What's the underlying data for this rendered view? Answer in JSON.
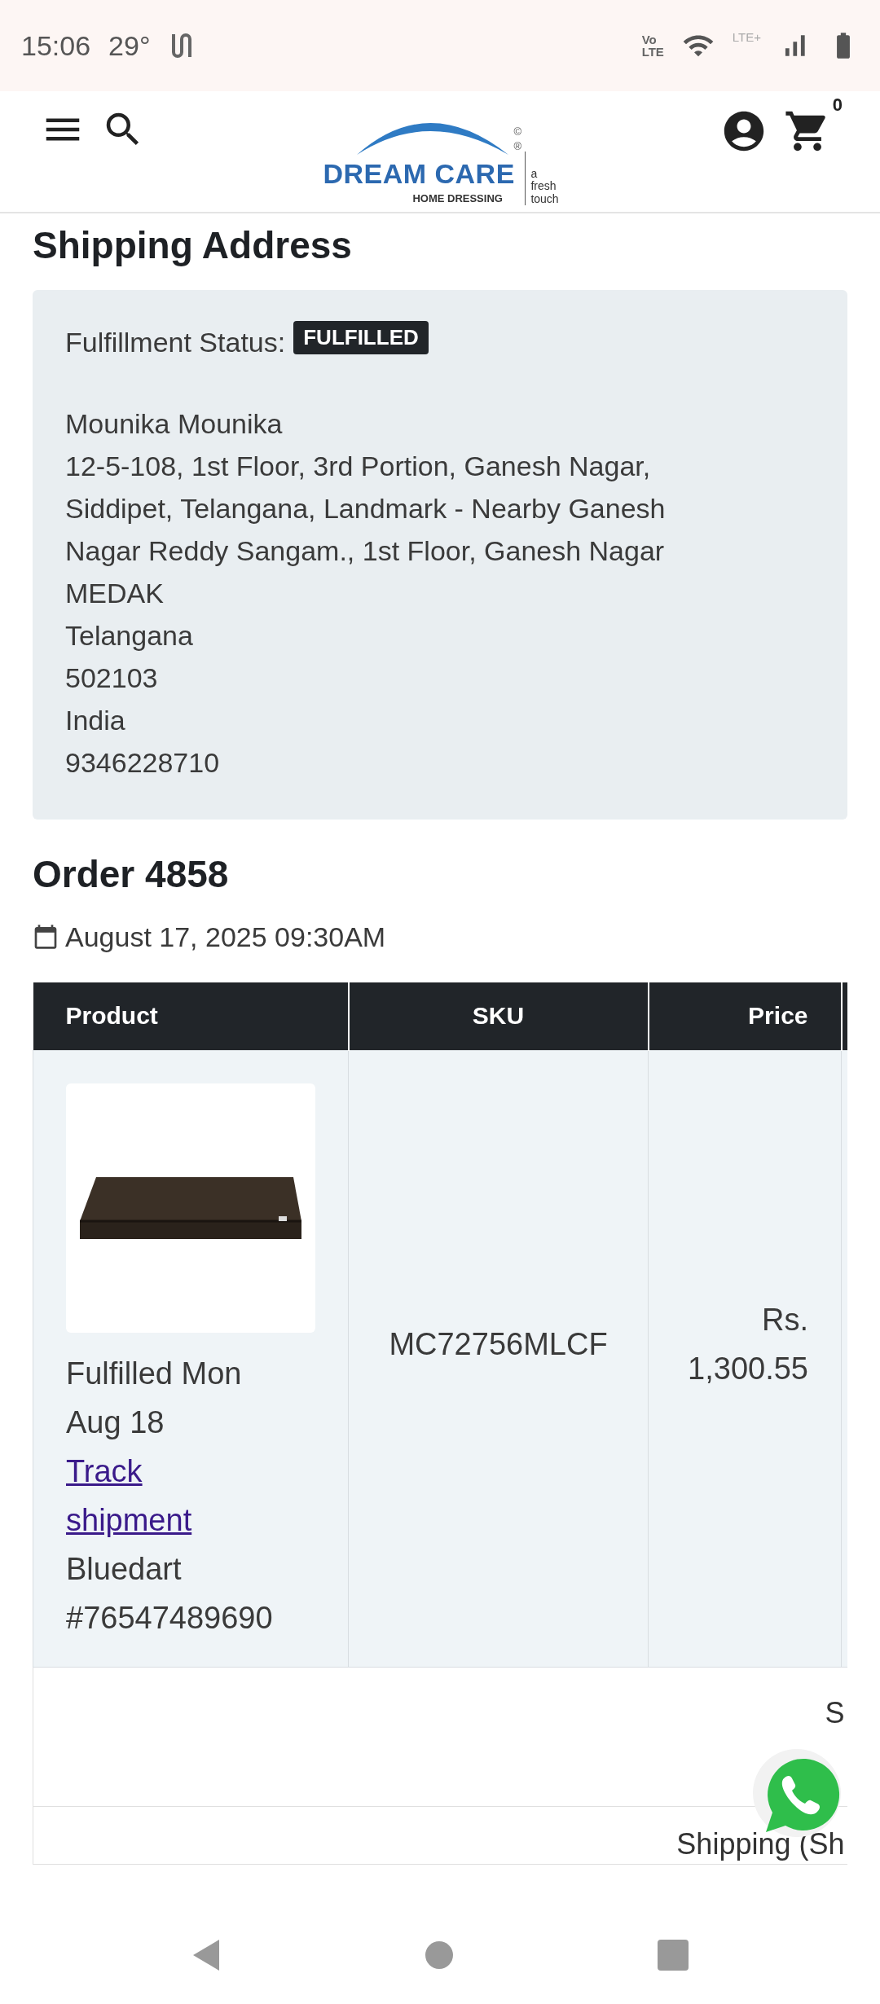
{
  "status_bar": {
    "time": "15:06",
    "temperature": "29°",
    "volte": [
      "Vo",
      "LTE"
    ],
    "network": "LTE+"
  },
  "header": {
    "cart_count": "0",
    "logo": {
      "name": "DREAM CARE",
      "tagline": "HOME DRESSING",
      "slogan": [
        "a",
        "fresh",
        "touch"
      ],
      "marks": [
        "©",
        "®"
      ]
    }
  },
  "shipping": {
    "title": "Shipping Address",
    "status_label": "Fulfillment Status:",
    "status_badge": "FULFILLED",
    "address_lines": [
      "Mounika Mounika",
      "12-5-108, 1st Floor, 3rd Portion, Ganesh Nagar,",
      "Siddipet, Telangana, Landmark - Nearby Ganesh",
      "Nagar Reddy Sangam., 1st Floor, Ganesh Nagar",
      "MEDAK",
      "Telangana",
      "502103",
      "India",
      "9346228710"
    ]
  },
  "order": {
    "title": "Order 4858",
    "date": "August 17, 2025 09:30AM"
  },
  "table": {
    "columns": [
      "Product",
      "SKU",
      "Price"
    ],
    "rows": [
      {
        "product": {
          "kind": "picture",
          "fulfilled": "Fulfilled Mon Aug 18",
          "track_link": "Track shipment",
          "carrier": "Bluedart",
          "tracking_number": "#76547489690"
        },
        "sku": "MC72756MLCF",
        "price": [
          "Rs.",
          "1,300.55"
        ]
      }
    ],
    "summary_rows": [
      "S",
      "Shipping (Sh"
    ]
  }
}
